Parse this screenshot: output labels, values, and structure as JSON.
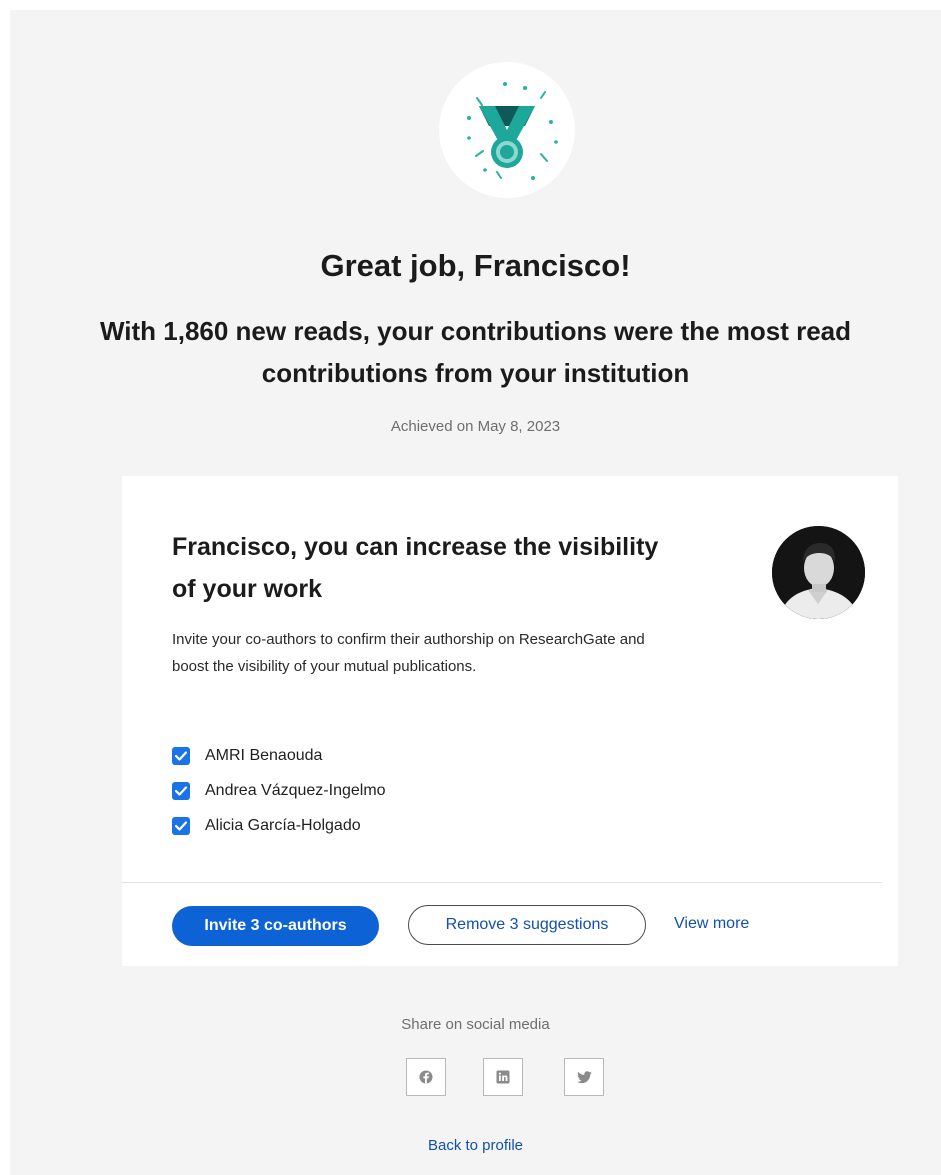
{
  "achievement": {
    "title": "Great job, Francisco!",
    "subtitle": "With 1,860 new reads, your contributions were the most read contributions from your institution",
    "achieved_date": "Achieved on May 8, 2023"
  },
  "visibility_card": {
    "title": "Francisco, you can increase the visibility of your work",
    "description": "Invite your co-authors to confirm their authorship on ResearchGate and boost the visibility of your mutual publications.",
    "coauthors": [
      {
        "name": "AMRI Benaouda",
        "checked": true
      },
      {
        "name": "Andrea Vázquez-Ingelmo",
        "checked": true
      },
      {
        "name": "Alicia García-Holgado",
        "checked": true
      }
    ],
    "invite_button": "Invite 3 co-authors",
    "remove_button": "Remove 3 suggestions",
    "view_more_link": "View more"
  },
  "share": {
    "label": "Share on social media",
    "networks": [
      {
        "icon": "facebook-icon"
      },
      {
        "icon": "linkedin-icon"
      },
      {
        "icon": "twitter-icon"
      }
    ]
  },
  "back_link": "Back to profile",
  "colors": {
    "primary": "#0d63d6",
    "link": "#1150b0",
    "medal_teal": "#1ea79b",
    "medal_dark": "#0f5a57",
    "background": "#f4f4f4"
  }
}
